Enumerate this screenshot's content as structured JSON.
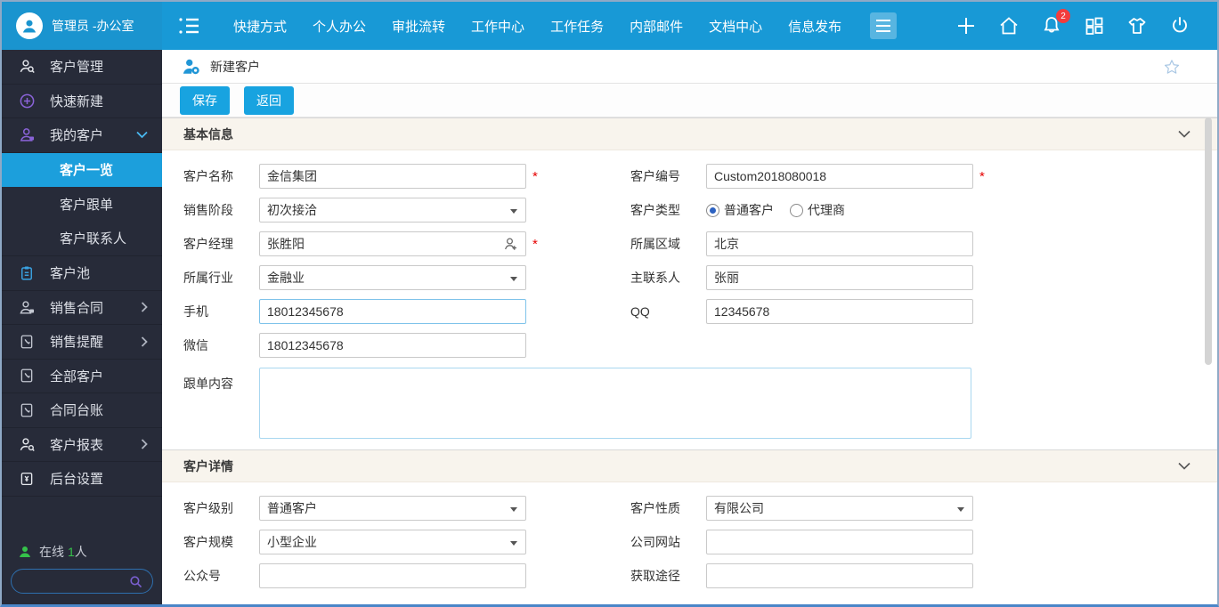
{
  "topbar": {
    "user": "管理员 -办公室",
    "nav": [
      "快捷方式",
      "个人办公",
      "审批流转",
      "工作中心",
      "工作任务",
      "内部邮件",
      "文档中心",
      "信息发布"
    ],
    "badge": "2"
  },
  "sidebar": {
    "items": [
      {
        "label": "客户管理"
      },
      {
        "label": "快速新建"
      },
      {
        "label": "我的客户"
      },
      {
        "label": "客户一览"
      },
      {
        "label": "客户跟单"
      },
      {
        "label": "客户联系人"
      },
      {
        "label": "客户池"
      },
      {
        "label": "销售合同"
      },
      {
        "label": "销售提醒"
      },
      {
        "label": "全部客户"
      },
      {
        "label": "合同台账"
      },
      {
        "label": "客户报表"
      },
      {
        "label": "后台设置"
      }
    ],
    "online": {
      "label": "在线",
      "count": "1",
      "unit": "人"
    },
    "search_placeholder": ""
  },
  "page": {
    "title": "新建客户",
    "toolbar": {
      "save": "保存",
      "back": "返回"
    },
    "required": "*"
  },
  "form": {
    "basic": {
      "title": "基本信息",
      "fields": {
        "customer_name": {
          "label": "客户名称",
          "value": "金信集团",
          "required": true
        },
        "customer_no": {
          "label": "客户编号",
          "value": "Custom2018080018",
          "required": true
        },
        "sales_stage": {
          "label": "销售阶段",
          "value": "初次接洽"
        },
        "customer_type": {
          "label": "客户类型",
          "options": [
            "普通客户",
            "代理商"
          ],
          "selected": "普通客户"
        },
        "customer_manager": {
          "label": "客户经理",
          "value": "张胜阳",
          "required": true
        },
        "region": {
          "label": "所属区域",
          "value": "北京"
        },
        "industry": {
          "label": "所属行业",
          "value": "金融业"
        },
        "main_contact": {
          "label": "主联系人",
          "value": "张丽"
        },
        "mobile": {
          "label": "手机",
          "value": "18012345678"
        },
        "qq": {
          "label": "QQ",
          "value": "12345678"
        },
        "wechat": {
          "label": "微信",
          "value": "18012345678"
        },
        "follow_content": {
          "label": "跟单内容",
          "value": ""
        }
      }
    },
    "detail": {
      "title": "客户详情",
      "fields": {
        "customer_level": {
          "label": "客户级别",
          "value": "普通客户"
        },
        "customer_nature": {
          "label": "客户性质",
          "value": "有限公司"
        },
        "customer_scale": {
          "label": "客户规模",
          "value": "小型企业"
        },
        "company_website": {
          "label": "公司网站",
          "value": ""
        },
        "public_account": {
          "label": "公众号",
          "value": ""
        },
        "acquire_channel": {
          "label": "获取途径",
          "value": ""
        }
      }
    }
  },
  "colors": {
    "topbar_blue": "#1899d6",
    "sidebar_dark": "#272b39",
    "selected_blue": "#1c9fdc",
    "button_blue": "#18a3e0",
    "section_cream": "#f8f4ed",
    "badge_red": "#f23c3c",
    "online_green": "#35c24a",
    "required_red": "#e60000",
    "focus_border": "#7fc3ea"
  },
  "icons": {
    "avatar": "person-circle",
    "collapse-menu-icon": "lines-with-dots",
    "hamburger-icon": "three-lines",
    "top_actions": [
      "plus-icon",
      "home-icon",
      "bell-icon",
      "apps-icon",
      "shirt-icon",
      "power-icon"
    ],
    "sidebar": [
      "person-search-icon",
      "plus-circle-icon",
      "person-icon",
      "clipboard-icon",
      "contact-book-icon",
      "report-icon",
      "settings-book-icon"
    ],
    "page_header": "person-gear-icon",
    "favorite": "star-icon",
    "search": "magnifier-icon",
    "field": "person-add-icon"
  }
}
